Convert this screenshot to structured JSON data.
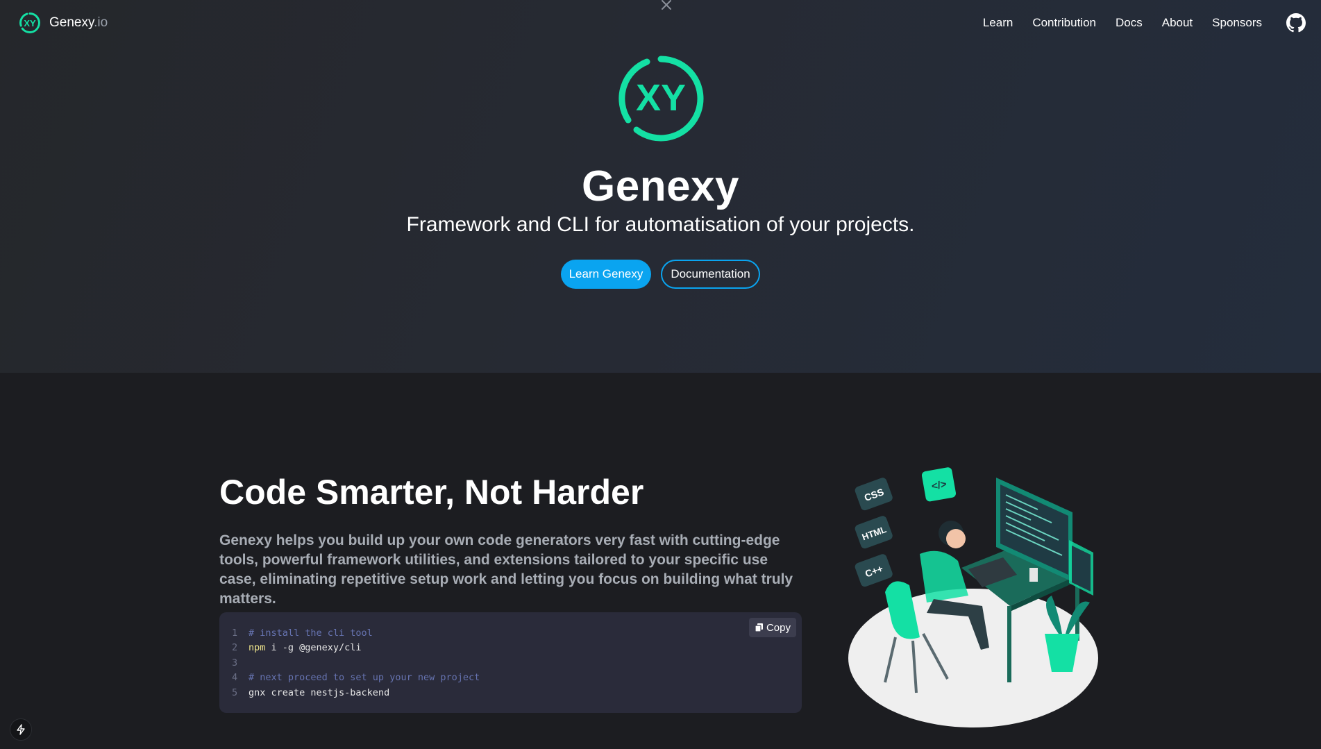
{
  "brand": {
    "name": "Genexy",
    "tld": ".io",
    "logo_text": "XY"
  },
  "nav": {
    "links": [
      "Learn",
      "Contribution",
      "Docs",
      "About",
      "Sponsors"
    ],
    "github_icon": "github-icon"
  },
  "hero": {
    "title": "Genexy",
    "subtitle": "Framework and CLI for automatisation of your projects.",
    "primary_button": "Learn Genexy",
    "secondary_button": "Documentation"
  },
  "feature": {
    "title": "Code Smarter, Not Harder",
    "description": "Genexy helps you build up your own code generators very fast with cutting-edge tools, powerful framework utilities, and extensions tailored to your specific use case, eliminating repetitive setup work and letting you focus on building what truly matters.",
    "copy_label": "Copy",
    "code": [
      {
        "n": "1",
        "comment": "# install the cli tool"
      },
      {
        "n": "2",
        "cmd": "npm",
        "rest": " i -g @genexy/cli"
      },
      {
        "n": "3"
      },
      {
        "n": "4",
        "comment": "# next proceed to set up your new project"
      },
      {
        "n": "5",
        "rest": "gnx create nestjs-backend"
      }
    ],
    "illustration_tags": [
      "CSS",
      "HTML",
      "C++",
      "</>"
    ]
  },
  "colors": {
    "accent_green": "#14e0a4",
    "accent_blue": "#0aa4f0",
    "background": "#1c1d21"
  }
}
